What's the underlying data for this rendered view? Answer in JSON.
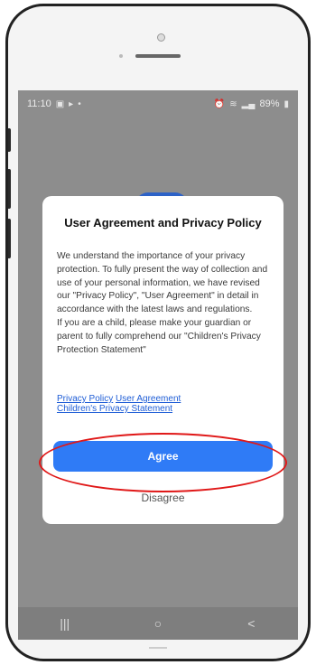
{
  "status_bar": {
    "time": "11:10",
    "battery": "89%"
  },
  "dialog": {
    "title": "User Agreement and Privacy Policy",
    "paragraph1": "We understand the importance of your privacy protection. To fully present the way of collection and use of your personal information, we have revised our \"Privacy Policy\", \"User Agreement\" in detail in accordance with the latest laws and regulations.",
    "paragraph2": "If you are a child, please make your guardian or parent to fully comprehend our \"Children's Privacy Protection Statement\"",
    "links": {
      "privacy_policy": "Privacy Policy",
      "user_agreement": "User Agreement",
      "childrens_privacy": "Children's Privacy Statement"
    },
    "agree_label": "Agree",
    "disagree_label": "Disagree"
  },
  "nav_bar": {
    "recents_glyph": "|||",
    "home_glyph": "○",
    "back_glyph": "<"
  },
  "colors": {
    "accent": "#2f7bf6",
    "link": "#1d5cd6",
    "highlight": "#e01818",
    "scrim": "#8d8d8d"
  }
}
